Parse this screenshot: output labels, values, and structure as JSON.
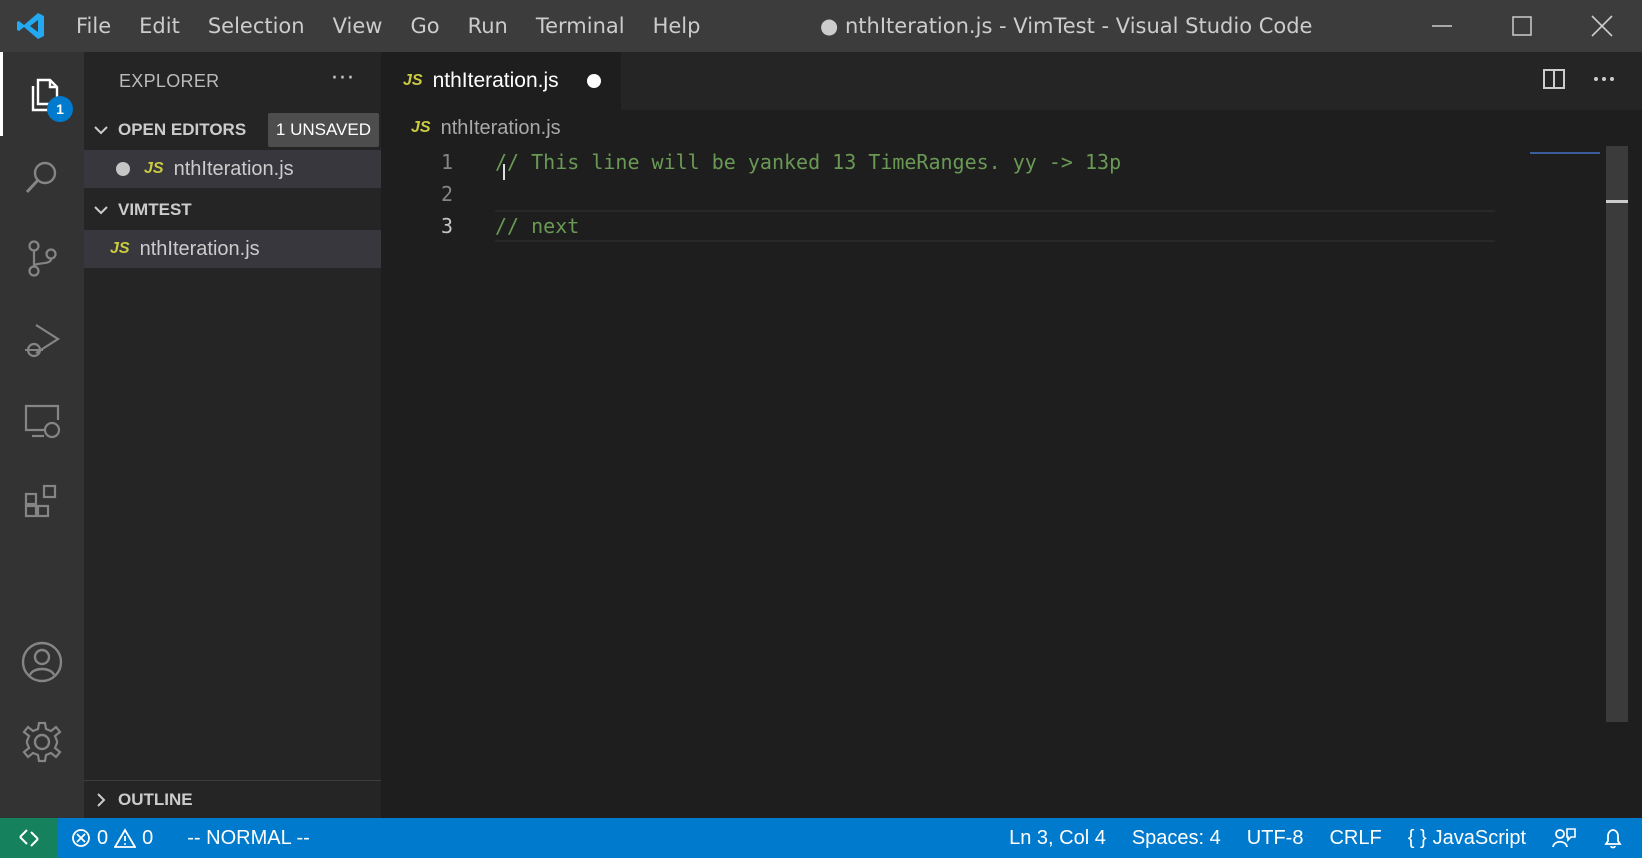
{
  "titlebar": {
    "menu": [
      "File",
      "Edit",
      "Selection",
      "View",
      "Go",
      "Run",
      "Terminal",
      "Help"
    ],
    "title": "● nthIteration.js - VimTest - Visual Studio Code"
  },
  "activitybar": {
    "explorer_badge": "1",
    "icons": [
      "files-icon",
      "search-icon",
      "source-control-icon",
      "run-debug-icon",
      "remote-explorer-icon",
      "extensions-icon",
      "accounts-icon",
      "manage-gear-icon"
    ]
  },
  "sidebar": {
    "title": "EXPLORER",
    "more": "···",
    "open_editors": {
      "title": "OPEN EDITORS",
      "badge": "1 UNSAVED",
      "files": [
        {
          "icon": "JS",
          "name": "nthIteration.js"
        }
      ]
    },
    "workspace": {
      "title": "VIMTEST",
      "files": [
        {
          "icon": "JS",
          "name": "nthIteration.js"
        }
      ]
    },
    "outline": {
      "title": "OUTLINE"
    }
  },
  "editor": {
    "tab": {
      "icon": "JS",
      "label": "nthIteration.js"
    },
    "breadcrumb": {
      "icon": "JS",
      "label": "nthIteration.js"
    },
    "lines": [
      {
        "number": "1",
        "text": "// This line will be yanked 13 TimeRanges. yy -> 13p"
      },
      {
        "number": "2",
        "text": ""
      },
      {
        "number": "3",
        "text": "// next"
      }
    ]
  },
  "statusbar": {
    "errors": "0",
    "warnings": "0",
    "vim_mode": "-- NORMAL --",
    "position": "Ln 3, Col 4",
    "spaces": "Spaces: 4",
    "encoding": "UTF-8",
    "eol": "CRLF",
    "language": "JavaScript",
    "language_icon": "{ }"
  },
  "colors": {
    "statusbar": "#007acc",
    "remote": "#16825d",
    "comment": "#6a9955",
    "js_icon": "#cbcb41"
  }
}
